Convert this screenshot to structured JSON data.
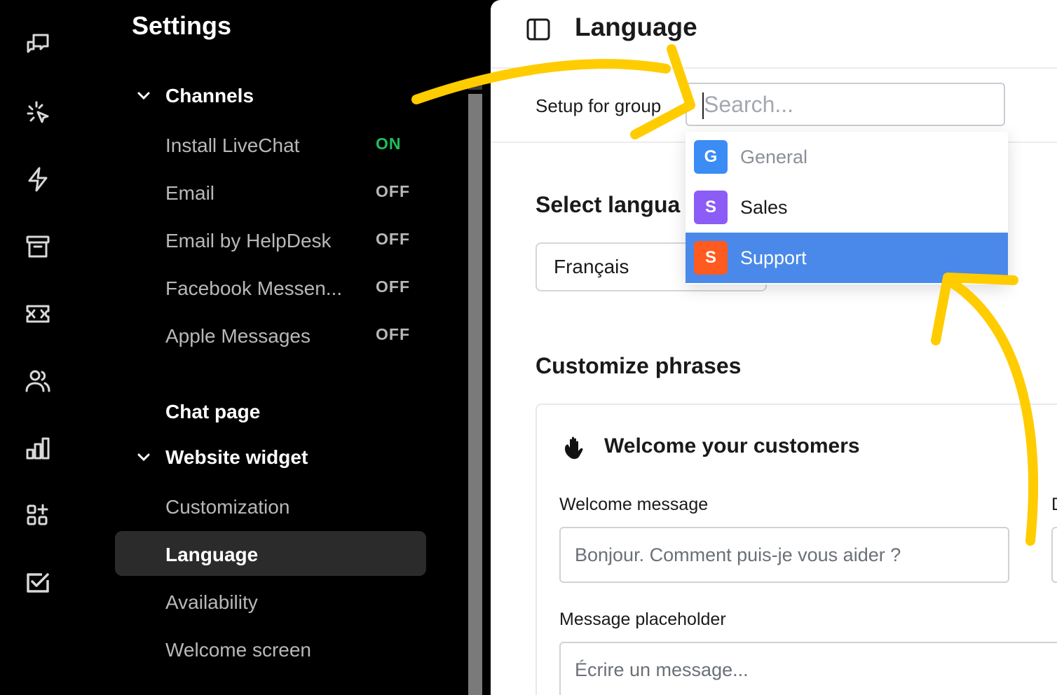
{
  "rail": {
    "icons": [
      "chats-icon",
      "engage-icon",
      "automate-icon",
      "archive-icon",
      "tickets-icon",
      "team-icon",
      "reports-icon",
      "apps-icon",
      "checklist-icon"
    ]
  },
  "nav": {
    "title": "Settings",
    "channels": {
      "label": "Channels",
      "items": [
        {
          "label": "Install LiveChat",
          "status": "ON"
        },
        {
          "label": "Email",
          "status": "OFF"
        },
        {
          "label": "Email by HelpDesk",
          "status": "OFF"
        },
        {
          "label": "Facebook Messen...",
          "status": "OFF"
        },
        {
          "label": "Apple Messages",
          "status": "OFF"
        }
      ]
    },
    "chat_page": "Chat page",
    "website_widget": {
      "label": "Website widget",
      "items": [
        "Customization",
        "Language",
        "Availability",
        "Welcome screen"
      ],
      "active": "Language"
    }
  },
  "main": {
    "title": "Language",
    "setup_label": "Setup for group",
    "search_placeholder": "Search...",
    "select_language_heading": "Select langua",
    "language_value": "Français",
    "dropdown": {
      "options": [
        {
          "initial": "G",
          "label": "General",
          "color": "#3b8cf4"
        },
        {
          "initial": "S",
          "label": "Sales",
          "color": "#8b5cf6"
        },
        {
          "initial": "S",
          "label": "Support",
          "color": "#ff5a1f"
        }
      ],
      "highlighted": "Support",
      "highlight_color": "#4a89ea"
    },
    "customize_heading": "Customize phrases",
    "card": {
      "title": "Welcome your customers",
      "welcome_label": "Welcome message",
      "welcome_placeholder": "Bonjour. Comment puis-je vous aider ?",
      "cut_label": "D",
      "placeholder_label": "Message placeholder",
      "placeholder_value": "Écrire un message..."
    }
  },
  "colors": {
    "on": "#1fbf5a",
    "annotation": "#ffcc00"
  }
}
